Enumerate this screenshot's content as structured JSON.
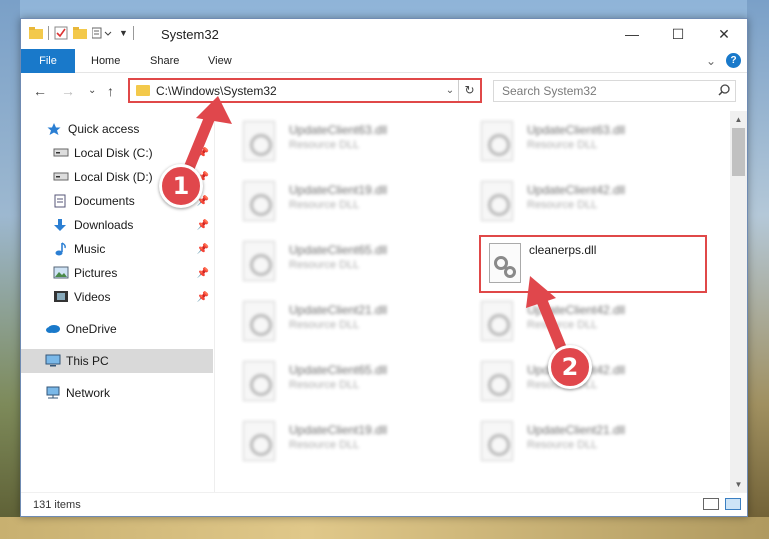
{
  "window": {
    "title": "System32",
    "controls": {
      "minimize": "—",
      "maximize": "☐",
      "close": "✕"
    }
  },
  "ribbon": {
    "tabs": [
      "File",
      "Home",
      "Share",
      "View"
    ],
    "expand": "⌄",
    "help": "?"
  },
  "address_bar": {
    "path": "C:\\Windows\\System32",
    "search_placeholder": "Search System32",
    "nav": {
      "back": "←",
      "forward": "→",
      "recent": "⌄",
      "up": "↑"
    },
    "refresh": "↻",
    "dropdown": "⌄"
  },
  "sidebar": {
    "items": [
      {
        "label": "Quick access",
        "icon": "star-icon",
        "pinned": false,
        "selected": false
      },
      {
        "label": "Local Disk (C:)",
        "icon": "drive-icon",
        "pinned": true,
        "selected": false
      },
      {
        "label": "Local Disk (D:)",
        "icon": "drive-icon",
        "pinned": true,
        "selected": false
      },
      {
        "label": "Documents",
        "icon": "documents-icon",
        "pinned": true,
        "selected": false
      },
      {
        "label": "Downloads",
        "icon": "download-icon",
        "pinned": true,
        "selected": false
      },
      {
        "label": "Music",
        "icon": "music-icon",
        "pinned": true,
        "selected": false
      },
      {
        "label": "Pictures",
        "icon": "pictures-icon",
        "pinned": true,
        "selected": false
      },
      {
        "label": "Videos",
        "icon": "videos-icon",
        "pinned": true,
        "selected": false
      },
      {
        "label": "OneDrive",
        "icon": "cloud-icon",
        "pinned": false,
        "selected": false
      },
      {
        "label": "This PC",
        "icon": "computer-icon",
        "pinned": false,
        "selected": true
      },
      {
        "label": "Network",
        "icon": "network-icon",
        "pinned": false,
        "selected": false
      }
    ]
  },
  "files": {
    "left_column": [
      {
        "name": "UpdateClient63.dll",
        "type": "Resource DLL"
      },
      {
        "name": "UpdateClient19.dll",
        "type": "Resource DLL"
      },
      {
        "name": "UpdateClient65.dll",
        "type": "Resource DLL"
      },
      {
        "name": "UpdateClient21.dll",
        "type": "Resource DLL"
      },
      {
        "name": "UpdateClient65.dll",
        "type": "Resource DLL"
      },
      {
        "name": "UpdateClient19.dll",
        "type": "Resource DLL"
      }
    ],
    "right_column": [
      {
        "name": "UpdateClient63.dll",
        "type": "Resource DLL"
      },
      {
        "name": "UpdateClient42.dll",
        "type": "Resource DLL"
      },
      {
        "name": "",
        "type": ""
      },
      {
        "name": "UpdateClient42.dll",
        "type": "Resource DLL"
      },
      {
        "name": "UpdateClient42.dll",
        "type": "Resource DLL"
      },
      {
        "name": "UpdateClient21.dll",
        "type": "Resource DLL"
      }
    ],
    "highlighted": {
      "name": "cleanerps.dll"
    }
  },
  "status": {
    "item_count": "131 items"
  },
  "annotations": {
    "badge1": "1",
    "badge2": "2"
  },
  "colors": {
    "accent": "#1979ca",
    "highlight": "#e04848",
    "badge": "#e0474c"
  }
}
